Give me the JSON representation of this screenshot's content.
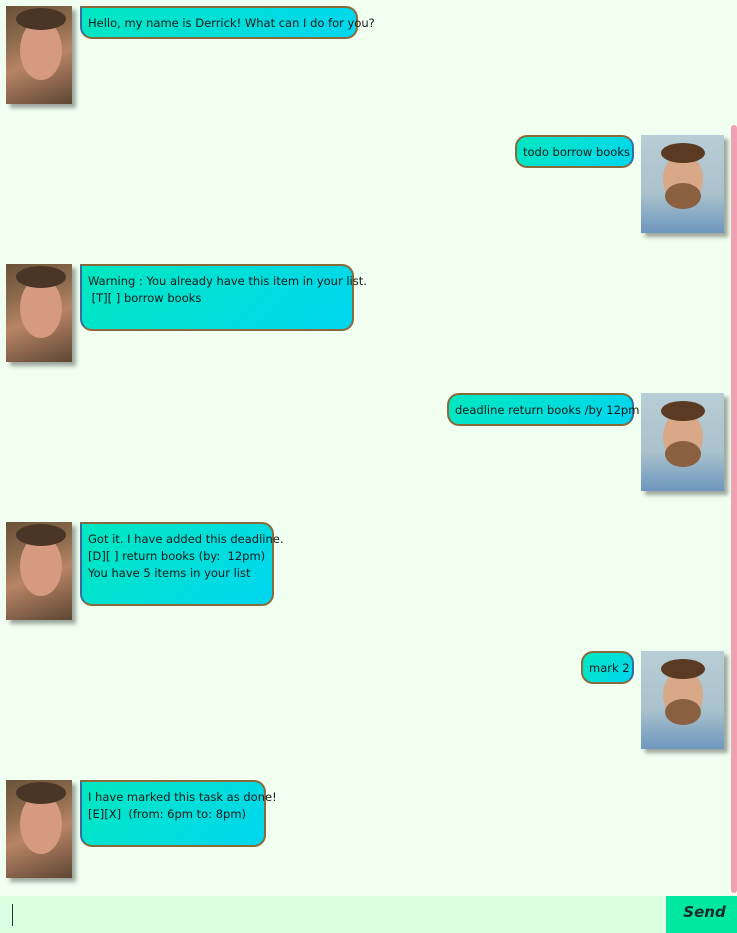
{
  "messages": [
    {
      "sender": "bot",
      "text": "Hello, my name is Derrick! What can I do for you?"
    },
    {
      "sender": "user",
      "text": "todo borrow books"
    },
    {
      "sender": "bot",
      "text": "Warning : You already have this item in your list.\n [T][ ] borrow books"
    },
    {
      "sender": "user",
      "text": "deadline return books /by 12pm"
    },
    {
      "sender": "bot",
      "text": "Got it. I have added this deadline.\n[D][ ] return books (by:  12pm)\nYou have 5 items in your list"
    },
    {
      "sender": "user",
      "text": "mark 2"
    },
    {
      "sender": "bot",
      "text": "I have marked this task as done!\n[E][X]  (from: 6pm to: 8pm)"
    }
  ],
  "input": {
    "value": "",
    "placeholder": ""
  },
  "send_label": "Send",
  "colors": {
    "background": "#f0fff0",
    "bubble_start": "#00e8c0",
    "bubble_end": "#00d6f0",
    "send_button": "#00e8a0",
    "input_bar": "#d8ffe0",
    "scrollbar": "#f0a0b0"
  }
}
